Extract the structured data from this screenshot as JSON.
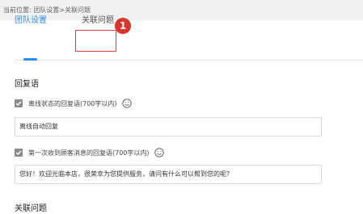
{
  "breadcrumb": {
    "text": "当前位置: 团队设置>关联问题"
  },
  "tabs": [
    {
      "label": "团队设置"
    },
    {
      "label": "关联问题"
    }
  ],
  "annotation": {
    "badge": "1"
  },
  "reply": {
    "title": "回复语",
    "offline": {
      "label": "离线状态的回复语(700字以内)",
      "value": "离线自动回复"
    },
    "first_msg": {
      "label": "第一次收到顾客消息的回复语(700字以内)",
      "value": "您好！欢迎光临本店，很荣幸为您提供服务，请问有什么可以帮到您的呢?"
    }
  },
  "related": {
    "title": "关联问题"
  },
  "colors": {
    "accent": "#2d8cf0",
    "annotation": "#d9352b"
  }
}
